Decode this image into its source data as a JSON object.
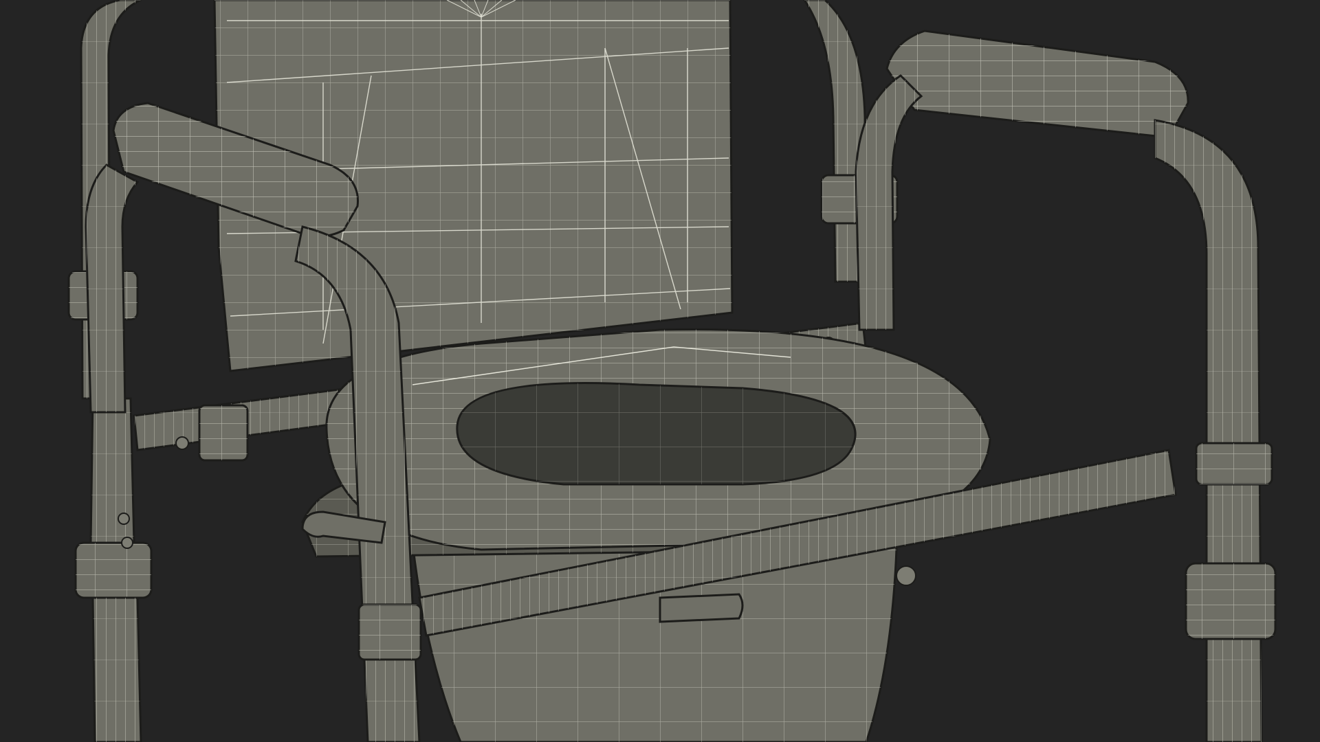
{
  "scene": {
    "subject": "commode-chair-wireframe",
    "colors": {
      "background": "#242424",
      "surface": "#6f6f66",
      "surface_dark": "#5a5a52",
      "surface_light": "#7d7d73",
      "inner_dark": "#3a3b36",
      "wire": "#e4e4d8",
      "outline": "#1c1c1a"
    }
  }
}
